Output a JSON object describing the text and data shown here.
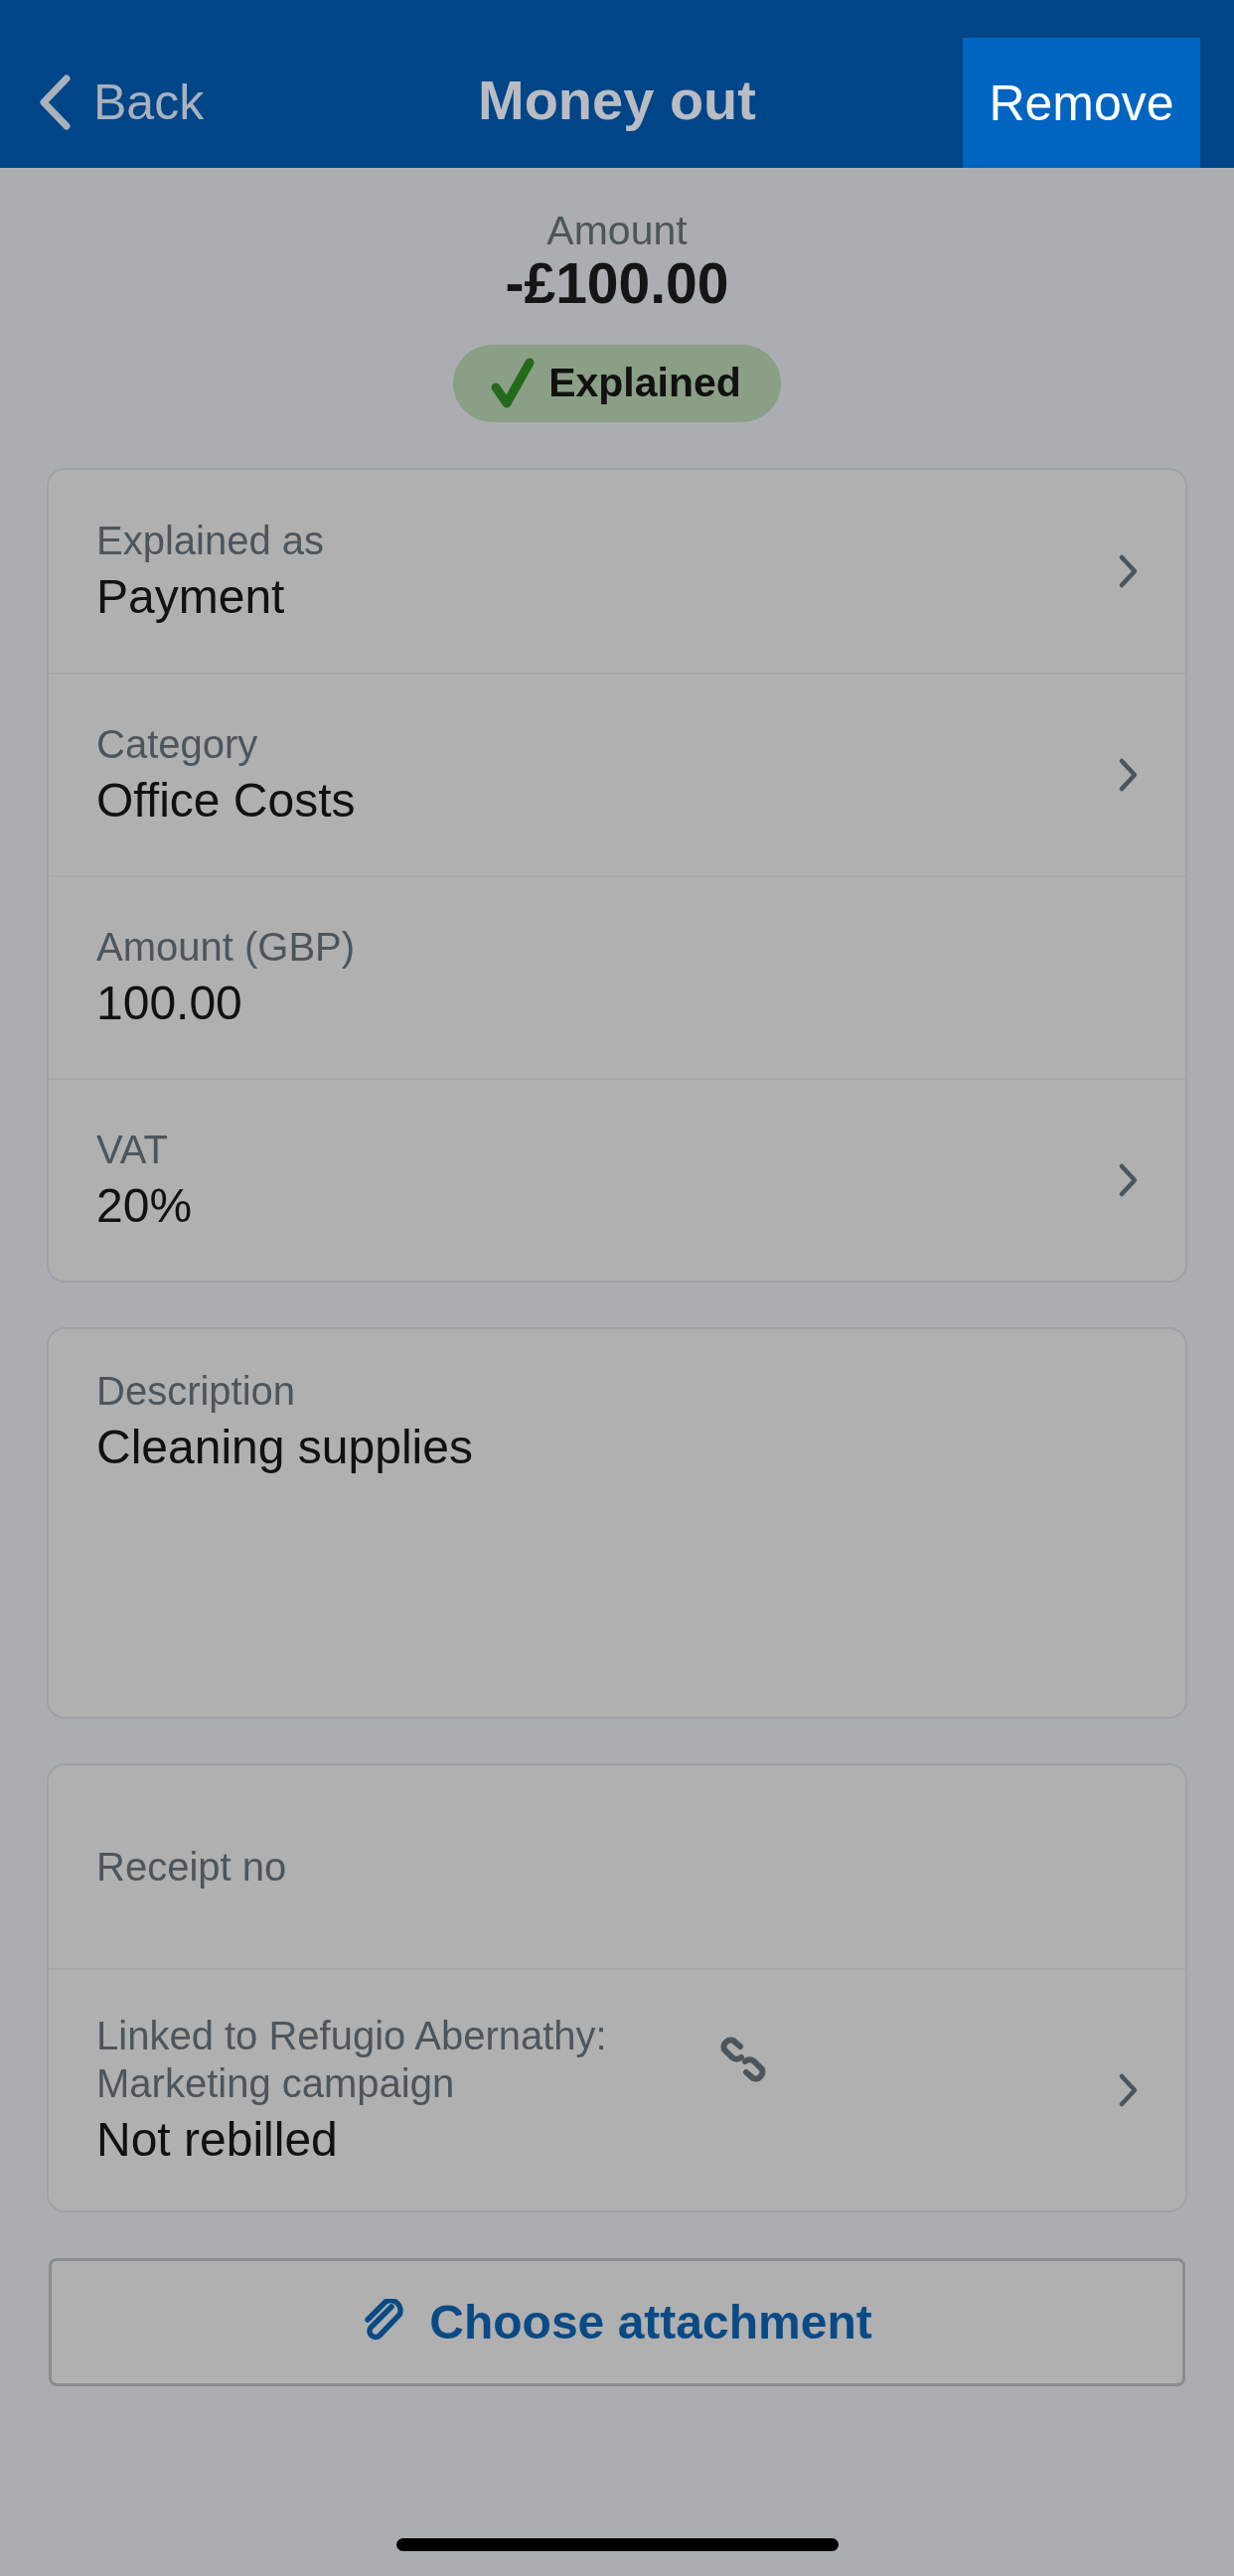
{
  "header": {
    "back": "Back",
    "title": "Money out",
    "action": "Remove"
  },
  "summary": {
    "label": "Amount",
    "amount": "-£100.00",
    "status": "Explained"
  },
  "cards": [
    {
      "rows": [
        {
          "kind": "select",
          "label": "Explained as",
          "value": "Payment"
        },
        {
          "kind": "select",
          "label": "Category",
          "value": "Office Costs"
        },
        {
          "kind": "input",
          "label": "Amount (GBP)",
          "value": "100.00"
        },
        {
          "kind": "select",
          "label": "VAT",
          "value": "20%"
        }
      ]
    },
    {
      "rows": [
        {
          "kind": "textarea",
          "label": "Description",
          "value": "Cleaning supplies"
        }
      ]
    },
    {
      "rows": [
        {
          "kind": "input",
          "label": "Receipt no"
        },
        {
          "kind": "linked",
          "label": "Linked to Refugio Abernathy: Marketing campaign",
          "value": "Not rebilled"
        }
      ]
    }
  ],
  "attachment_button": "Choose attachment"
}
